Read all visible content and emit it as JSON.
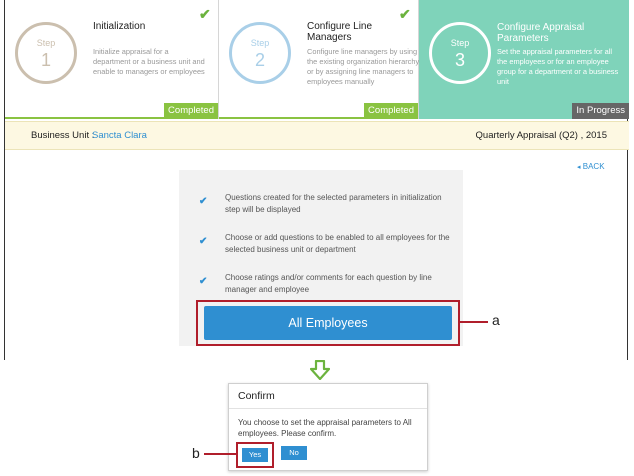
{
  "steps": [
    {
      "step_label": "Step",
      "number": "1",
      "title": "Initialization",
      "description": "Initialize appraisal for a department or a business unit and enable to managers or employees",
      "status": "Completed"
    },
    {
      "step_label": "Step",
      "number": "2",
      "title": "Configure Line Managers",
      "description": "Configure line managers by using the existing organization hierarchy or by assigning line managers to employees manually",
      "status": "Completed"
    },
    {
      "step_label": "Step",
      "number": "3",
      "title": "Configure Appraisal Parameters",
      "description": "Set the appraisal parameters for all the employees or for an employee group for a department or a business unit",
      "status": "In Progress"
    }
  ],
  "business_unit": {
    "label": "Business Unit :",
    "value": "Sancta Clara"
  },
  "period": "Quarterly Appraisal (Q2) , 2015",
  "back": {
    "arrow": "◂",
    "label": "BACK"
  },
  "info_items": [
    "Questions created for the selected parameters in initialization step will be displayed",
    "Choose or add questions to be enabled to all employees for the selected business unit or department",
    "Choose ratings and/or comments for each question by line manager and employee"
  ],
  "all_employees_button": "All Employees",
  "callouts": {
    "a": "a",
    "b": "b"
  },
  "dialog": {
    "title": "Confirm",
    "message": "You choose to set the appraisal parameters to All employees. Please confirm.",
    "yes": "Yes",
    "no": "No"
  },
  "colors": {
    "accent": "#2f8fd1",
    "completed": "#8ac341",
    "active_step": "#7fd3ba",
    "highlight": "#b01e2b",
    "arrow": "#6cb33e"
  },
  "icons": {
    "check": "check-icon",
    "tick": "tick-icon",
    "back": "back-arrow-icon",
    "down": "down-arrow-icon"
  }
}
